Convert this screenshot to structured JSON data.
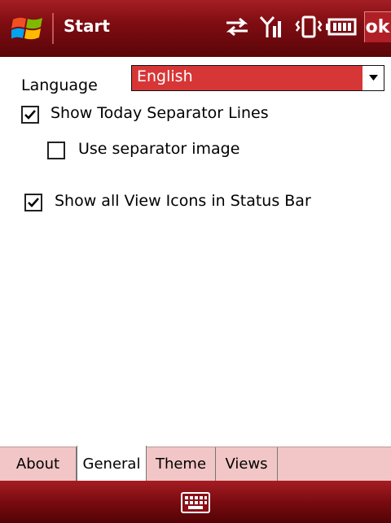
{
  "window": {
    "title": "Start",
    "ok_label": "ok"
  },
  "status_icons": [
    "sync-arrows-icon",
    "signal-strength-icon",
    "vibrate-icon",
    "battery-icon"
  ],
  "settings": {
    "language_label": "Language",
    "language_value": "English",
    "show_today_separator": {
      "label": "Show Today Separator Lines",
      "checked": true
    },
    "use_separator_image": {
      "label": "Use separator image",
      "checked": false
    },
    "show_view_icons": {
      "label": "Show all View Icons in Status Bar",
      "checked": true
    }
  },
  "tabs": [
    {
      "label": "About",
      "active": false
    },
    {
      "label": "General",
      "active": true
    },
    {
      "label": "Theme",
      "active": false
    },
    {
      "label": "Views",
      "active": false
    }
  ],
  "colors": {
    "accent": "#d73637",
    "titlebar": "#7f0d12",
    "tab_strip": "#f2c6c6"
  }
}
